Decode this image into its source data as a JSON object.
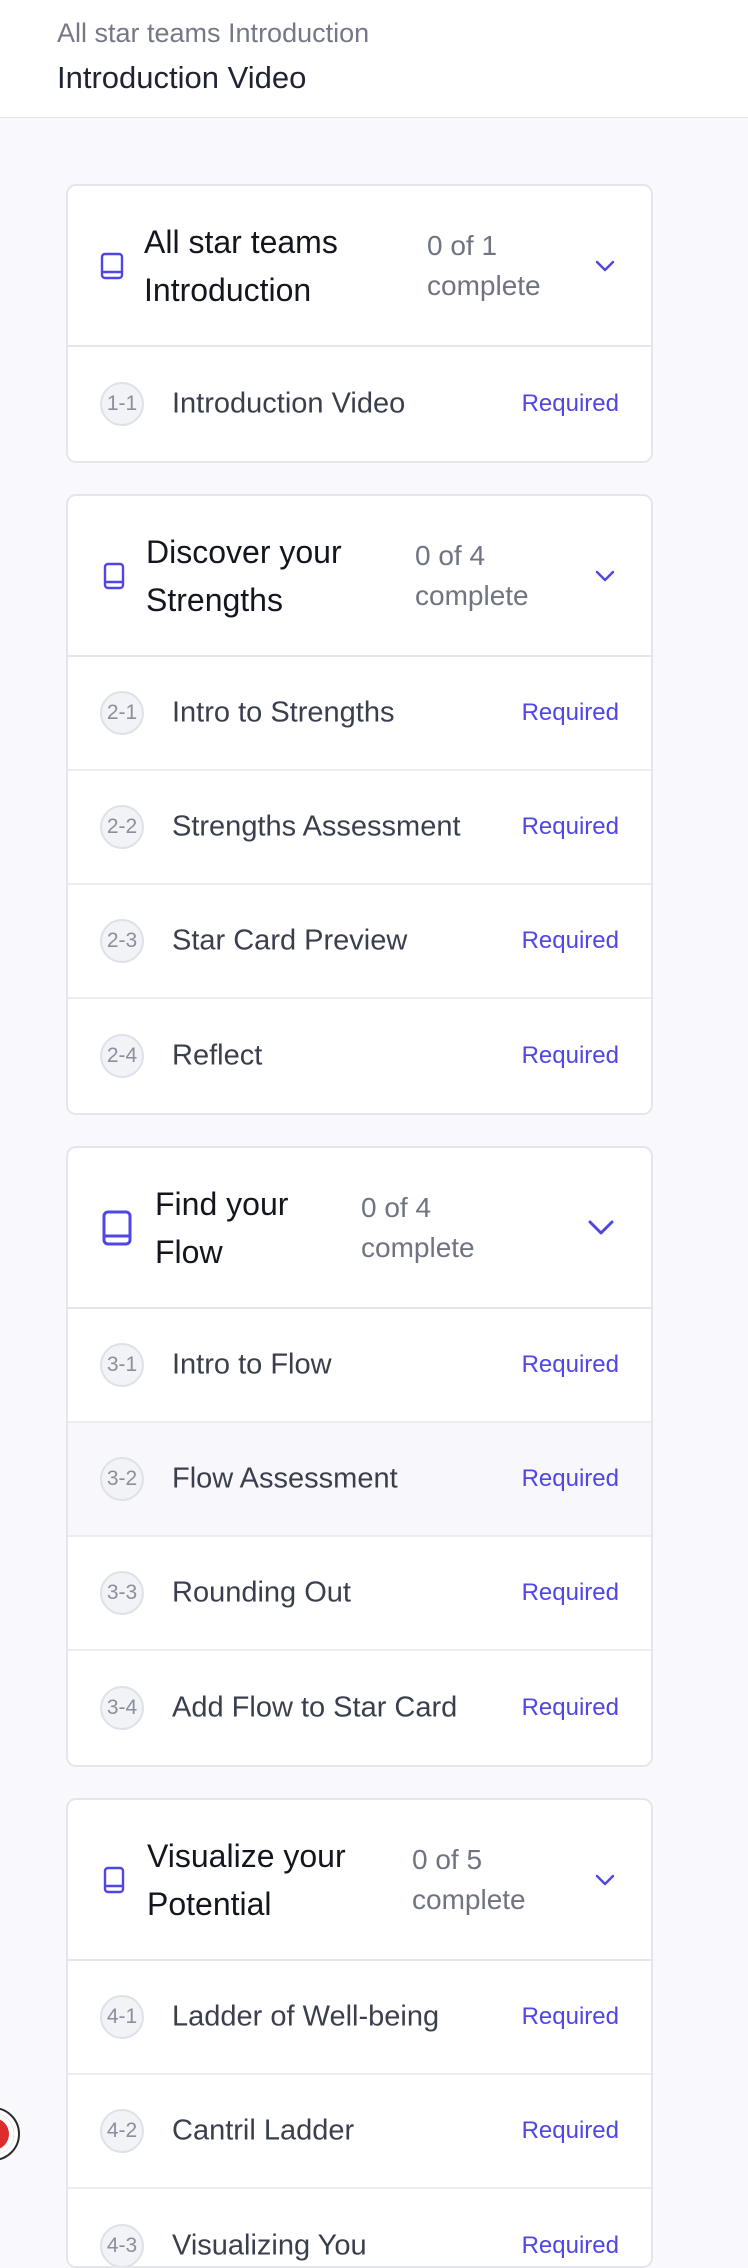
{
  "header": {
    "breadcrumb": "All star teams Introduction",
    "title": "Introduction Video"
  },
  "colors": {
    "accent": "#4f46e5",
    "page_background": "#f8f8fd",
    "fab_red": "#dc2c2c"
  },
  "icons": {
    "section_icon": "book-icon",
    "toggle_icon": "chevron-down-icon",
    "floating_button": "record-button-icon"
  },
  "sections": [
    {
      "title_line1": "All star teams",
      "title_line2": "Introduction",
      "progress_line1": "0 of 1",
      "progress_line2": "complete",
      "items": [
        {
          "number": "1-1",
          "label": "Introduction Video",
          "status": "Required"
        }
      ]
    },
    {
      "title_line1": "Discover your",
      "title_line2": "Strengths",
      "progress_line1": "0 of 4",
      "progress_line2": "complete",
      "items": [
        {
          "number": "2-1",
          "label": "Intro to Strengths",
          "status": "Required"
        },
        {
          "number": "2-2",
          "label": "Strengths Assessment",
          "status": "Required"
        },
        {
          "number": "2-3",
          "label": "Star Card Preview",
          "status": "Required"
        },
        {
          "number": "2-4",
          "label": "Reflect",
          "status": "Required"
        }
      ]
    },
    {
      "title_line1": "Find your",
      "title_line2": "Flow",
      "progress_line1": "0 of 4",
      "progress_line2": "complete",
      "items": [
        {
          "number": "3-1",
          "label": "Intro to Flow",
          "status": "Required"
        },
        {
          "number": "3-2",
          "label": "Flow Assessment",
          "status": "Required"
        },
        {
          "number": "3-3",
          "label": "Rounding Out",
          "status": "Required"
        },
        {
          "number": "3-4",
          "label": "Add Flow to Star Card",
          "status": "Required"
        }
      ]
    },
    {
      "title_line1": "Visualize your",
      "title_line2": "Potential",
      "progress_line1": "0 of 5",
      "progress_line2": "complete",
      "items": [
        {
          "number": "4-1",
          "label": "Ladder of Well-being",
          "status": "Required"
        },
        {
          "number": "4-2",
          "label": "Cantril Ladder",
          "status": "Required"
        },
        {
          "number": "4-3",
          "label": "Visualizing You",
          "status": "Required"
        }
      ]
    }
  ]
}
